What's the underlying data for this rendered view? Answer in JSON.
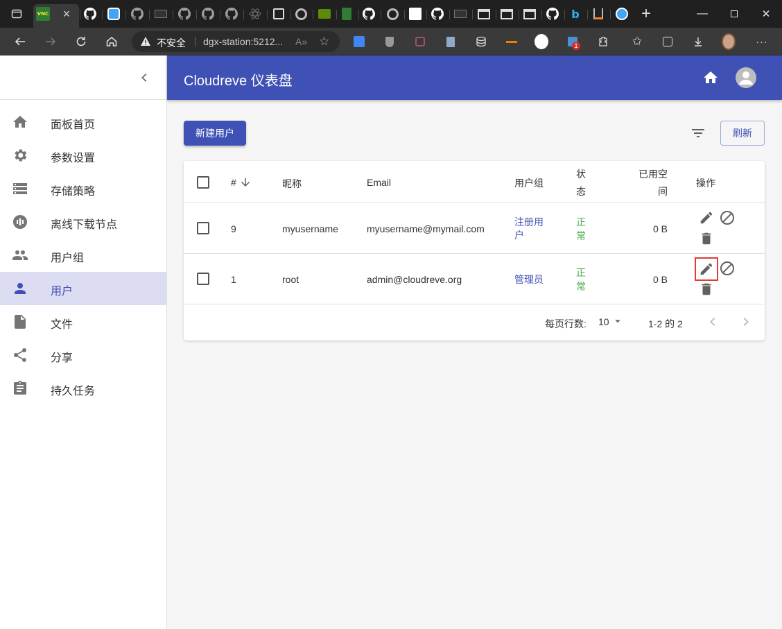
{
  "browser": {
    "address_insecure_label": "不安全",
    "address_url": "dgx-station:5212...",
    "vnc_tab_text": "VNC",
    "notification_count": "1",
    "close_tab_glyph": "×",
    "new_tab_glyph": "+",
    "minimize_glyph": "—",
    "close_window_glyph": "✕",
    "menu_glyph": "···"
  },
  "app": {
    "title": "Cloudreve 仪表盘"
  },
  "sidebar": {
    "items": [
      {
        "label": "面板首页",
        "icon": "home-icon"
      },
      {
        "label": "参数设置",
        "icon": "gear-icon"
      },
      {
        "label": "存储策略",
        "icon": "storage-icon"
      },
      {
        "label": "离线下载节点",
        "icon": "offline-download-icon"
      },
      {
        "label": "用户组",
        "icon": "group-icon"
      },
      {
        "label": "用户",
        "icon": "person-icon",
        "active": true
      },
      {
        "label": "文件",
        "icon": "file-icon"
      },
      {
        "label": "分享",
        "icon": "share-icon"
      },
      {
        "label": "持久任务",
        "icon": "task-icon"
      }
    ]
  },
  "toolbar": {
    "new_user_label": "新建用户",
    "refresh_label": "刷新"
  },
  "table": {
    "headers": {
      "id": "#",
      "nickname": "昵称",
      "email": "Email",
      "group": "用户组",
      "status_line1": "状",
      "status_line2": "态",
      "used_line1": "已用空",
      "used_line2": "间",
      "actions": "操作"
    },
    "rows": [
      {
        "id": "9",
        "nickname": "myusername",
        "email": "myusername@mymail.com",
        "group_line1": "注册用",
        "group_line2": "户",
        "status_line1": "正",
        "status_line2": "常",
        "used": "0 B"
      },
      {
        "id": "1",
        "nickname": "root",
        "email": "admin@cloudreve.org",
        "group_line1": "管理员",
        "group_line2": "",
        "status_line1": "正",
        "status_line2": "常",
        "used": "0 B"
      }
    ],
    "footer": {
      "rows_per_page_label": "每页行数:",
      "rows_per_page_value": "10",
      "range_text": "1-2 的 2"
    }
  },
  "colors": {
    "primary": "#3f51b5",
    "status_ok": "#4caf50",
    "selected_nav": "#dcdcf3",
    "highlight": "#e53935"
  }
}
